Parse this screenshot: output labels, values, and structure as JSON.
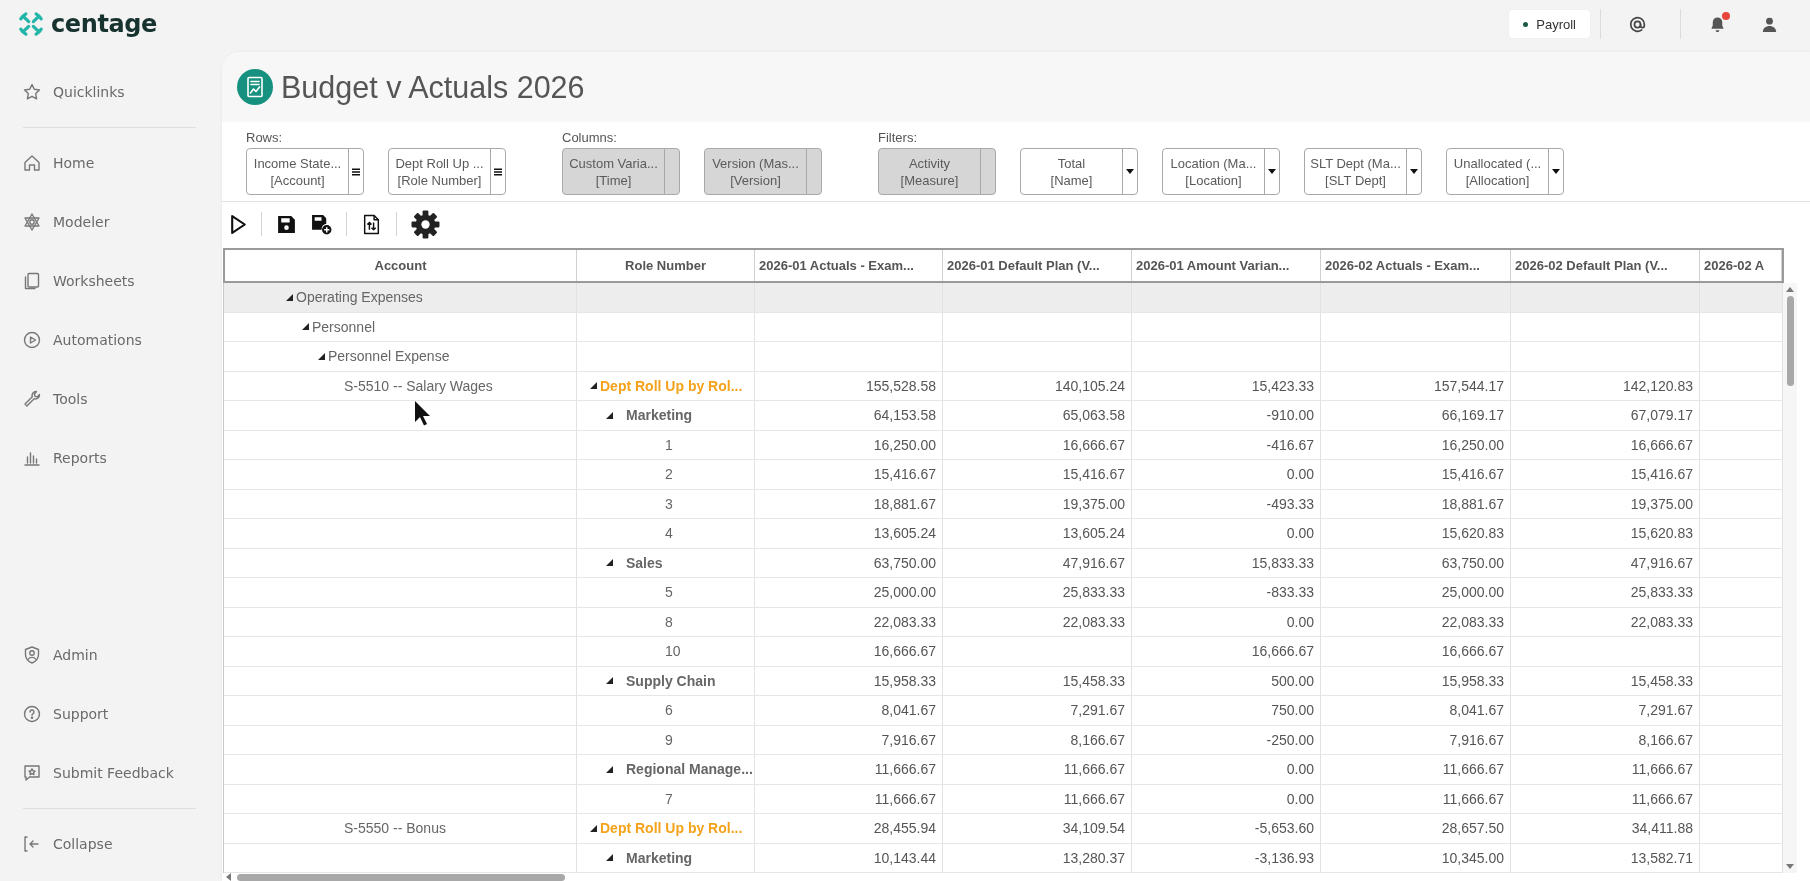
{
  "topbar": {
    "brand": "centage",
    "workspace": "Payroll",
    "notifications_unread": true
  },
  "sidebar": {
    "quick_items": [
      "Quicklinks"
    ],
    "nav_items": [
      "Home",
      "Modeler",
      "Worksheets",
      "Automations",
      "Tools",
      "Reports"
    ],
    "support_items": [
      "Admin",
      "Support",
      "Submit Feedback"
    ],
    "collapse": "Collapse"
  },
  "page": {
    "title": "Budget v Actuals 2026"
  },
  "pivot": {
    "groups": [
      {
        "label": "Rows:",
        "fields": [
          {
            "title": "Income State...",
            "dimension": "[Account]",
            "kind": "menu"
          },
          {
            "title": "Dept Roll Up ...",
            "dimension": "[Role Number]",
            "kind": "menu"
          }
        ]
      },
      {
        "label": "Columns:",
        "fields": [
          {
            "title": "Custom Varia...",
            "dimension": "[Time]",
            "kind": "fixed"
          },
          {
            "title": "Version (Mas...",
            "dimension": "[Version]",
            "kind": "fixed"
          }
        ]
      },
      {
        "label": "Filters:",
        "fields": [
          {
            "title": "Activity",
            "dimension": "[Measure]",
            "kind": "fixed"
          },
          {
            "title": "Total",
            "dimension": "[Name]",
            "kind": "dropdown"
          },
          {
            "title": "Location (Ma...",
            "dimension": "[Location]",
            "kind": "dropdown"
          },
          {
            "title": "SLT Dept (Ma...",
            "dimension": "[SLT Dept]",
            "kind": "dropdown"
          },
          {
            "title": "Unallocated (...",
            "dimension": "[Allocation]",
            "kind": "dropdown"
          }
        ]
      }
    ]
  },
  "table": {
    "columns": [
      "Account",
      "Role Number",
      "2026-01 Actuals - Exam...",
      "2026-01 Default Plan (V...",
      "2026-01 Amount Varian...",
      "2026-02 Actuals - Exam...",
      "2026-02 Default Plan (V...",
      "2026-02 A"
    ],
    "rows": [
      {
        "label": "Operating Expenses",
        "expanded": true,
        "children": [
          {
            "label": "Personnel",
            "expanded": true,
            "children": [
              {
                "label": "Personnel Expense",
                "expanded": true,
                "children": [
                  {
                    "label": "S-5510 -- Salary Wages",
                    "roles": [
                      {
                        "label": "Dept Roll Up by Rol...",
                        "expanded": true,
                        "values": {
                          "actual_2026_01": "155,528.58",
                          "plan_2026_01": "140,105.24",
                          "variance_2026_01": "15,423.33",
                          "actual_2026_02": "157,544.17",
                          "plan_2026_02": "142,120.83"
                        },
                        "children": [
                          {
                            "label": "Marketing",
                            "expanded": true,
                            "values": {
                              "actual_2026_01": "64,153.58",
                              "plan_2026_01": "65,063.58",
                              "variance_2026_01": "-910.00",
                              "actual_2026_02": "66,169.17",
                              "plan_2026_02": "67,079.17"
                            },
                            "children": [
                              {
                                "label": "1",
                                "values": {
                                  "actual_2026_01": "16,250.00",
                                  "plan_2026_01": "16,666.67",
                                  "variance_2026_01": "-416.67",
                                  "actual_2026_02": "16,250.00",
                                  "plan_2026_02": "16,666.67"
                                }
                              },
                              {
                                "label": "2",
                                "values": {
                                  "actual_2026_01": "15,416.67",
                                  "plan_2026_01": "15,416.67",
                                  "variance_2026_01": "0.00",
                                  "actual_2026_02": "15,416.67",
                                  "plan_2026_02": "15,416.67"
                                }
                              },
                              {
                                "label": "3",
                                "values": {
                                  "actual_2026_01": "18,881.67",
                                  "plan_2026_01": "19,375.00",
                                  "variance_2026_01": "-493.33",
                                  "actual_2026_02": "18,881.67",
                                  "plan_2026_02": "19,375.00"
                                }
                              },
                              {
                                "label": "4",
                                "values": {
                                  "actual_2026_01": "13,605.24",
                                  "plan_2026_01": "13,605.24",
                                  "variance_2026_01": "0.00",
                                  "actual_2026_02": "15,620.83",
                                  "plan_2026_02": "15,620.83"
                                }
                              }
                            ]
                          },
                          {
                            "label": "Sales",
                            "expanded": true,
                            "values": {
                              "actual_2026_01": "63,750.00",
                              "plan_2026_01": "47,916.67",
                              "variance_2026_01": "15,833.33",
                              "actual_2026_02": "63,750.00",
                              "plan_2026_02": "47,916.67"
                            },
                            "children": [
                              {
                                "label": "5",
                                "values": {
                                  "actual_2026_01": "25,000.00",
                                  "plan_2026_01": "25,833.33",
                                  "variance_2026_01": "-833.33",
                                  "actual_2026_02": "25,000.00",
                                  "plan_2026_02": "25,833.33"
                                }
                              },
                              {
                                "label": "8",
                                "values": {
                                  "actual_2026_01": "22,083.33",
                                  "plan_2026_01": "22,083.33",
                                  "variance_2026_01": "0.00",
                                  "actual_2026_02": "22,083.33",
                                  "plan_2026_02": "22,083.33"
                                }
                              },
                              {
                                "label": "10",
                                "values": {
                                  "actual_2026_01": "16,666.67",
                                  "variance_2026_01": "16,666.67",
                                  "actual_2026_02": "16,666.67"
                                }
                              }
                            ]
                          },
                          {
                            "label": "Supply Chain",
                            "expanded": true,
                            "values": {
                              "actual_2026_01": "15,958.33",
                              "plan_2026_01": "15,458.33",
                              "variance_2026_01": "500.00",
                              "actual_2026_02": "15,958.33",
                              "plan_2026_02": "15,458.33"
                            },
                            "children": [
                              {
                                "label": "6",
                                "values": {
                                  "actual_2026_01": "8,041.67",
                                  "plan_2026_01": "7,291.67",
                                  "variance_2026_01": "750.00",
                                  "actual_2026_02": "8,041.67",
                                  "plan_2026_02": "7,291.67"
                                }
                              },
                              {
                                "label": "9",
                                "values": {
                                  "actual_2026_01": "7,916.67",
                                  "plan_2026_01": "8,166.67",
                                  "variance_2026_01": "-250.00",
                                  "actual_2026_02": "7,916.67",
                                  "plan_2026_02": "8,166.67"
                                }
                              }
                            ]
                          },
                          {
                            "label": "Regional Manage...",
                            "expanded": true,
                            "values": {
                              "actual_2026_01": "11,666.67",
                              "plan_2026_01": "11,666.67",
                              "variance_2026_01": "0.00",
                              "actual_2026_02": "11,666.67",
                              "plan_2026_02": "11,666.67"
                            },
                            "children": [
                              {
                                "label": "7",
                                "values": {
                                  "actual_2026_01": "11,666.67",
                                  "plan_2026_01": "11,666.67",
                                  "variance_2026_01": "0.00",
                                  "actual_2026_02": "11,666.67",
                                  "plan_2026_02": "11,666.67"
                                }
                              }
                            ]
                          }
                        ]
                      }
                    ]
                  },
                  {
                    "label": "S-5550 -- Bonus",
                    "roles": [
                      {
                        "label": "Dept Roll Up by Rol...",
                        "expanded": true,
                        "values": {
                          "actual_2026_01": "28,455.94",
                          "plan_2026_01": "34,109.54",
                          "variance_2026_01": "-5,653.60",
                          "actual_2026_02": "28,657.50",
                          "plan_2026_02": "34,411.88"
                        },
                        "children": [
                          {
                            "label": "Marketing",
                            "expanded": true,
                            "values": {
                              "actual_2026_01": "10,143.44",
                              "plan_2026_01": "13,280.37",
                              "variance_2026_01": "-3,136.93",
                              "actual_2026_02": "10,345.00",
                              "plan_2026_02": "13,582.71"
                            }
                          }
                        ]
                      }
                    ]
                  }
                ]
              }
            ]
          }
        ]
      }
    ]
  }
}
